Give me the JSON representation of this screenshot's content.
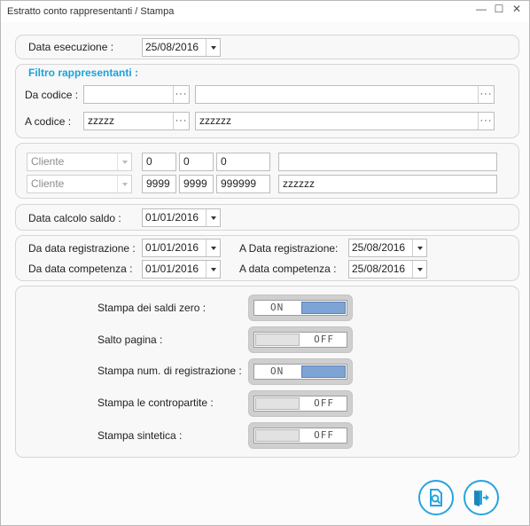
{
  "window": {
    "title": "Estratto conto rappresentanti / Stampa",
    "controls": {
      "minimize": "—",
      "maximize": "☐",
      "close": "✕"
    }
  },
  "execution": {
    "label": "Data esecuzione :",
    "date": "25/08/2016"
  },
  "agents_filter": {
    "title": "Filtro rappresentanti :",
    "from_label": "Da codice :",
    "from_code": "",
    "from_desc": "",
    "to_label": "A codice :",
    "to_code": "zzzzz",
    "to_desc": "zzzzzz",
    "ellipsis": "···"
  },
  "client_range": {
    "rows": [
      {
        "type": "Cliente",
        "v1": "0",
        "v2": "0",
        "v3": "0",
        "desc": ""
      },
      {
        "type": "Cliente",
        "v1": "9999",
        "v2": "9999",
        "v3": "999999",
        "desc": "zzzzzz"
      }
    ]
  },
  "balance": {
    "label": "Data calcolo saldo :",
    "date": "01/01/2016"
  },
  "dates": {
    "reg_from_label": "Da data registrazione :",
    "reg_from": "01/01/2016",
    "reg_to_label": "A Data registrazione:",
    "reg_to": "25/08/2016",
    "comp_from_label": "Da data competenza :",
    "comp_from": "01/01/2016",
    "comp_to_label": "A data competenza :",
    "comp_to": "25/08/2016"
  },
  "options": [
    {
      "label": "Stampa dei saldi zero :",
      "state": "ON"
    },
    {
      "label": "Salto pagina :",
      "state": "OFF"
    },
    {
      "label": "Stampa num. di registrazione :",
      "state": "ON"
    },
    {
      "label": "Stampa le contropartite :",
      "state": "OFF"
    },
    {
      "label": "Stampa sintetica :",
      "state": "OFF"
    }
  ],
  "colors": {
    "accent": "#1aa3dc",
    "toggle_on": "#7ea4d6"
  },
  "actions": {
    "preview_icon": "print-preview-icon",
    "exit_icon": "exit-door-icon"
  }
}
